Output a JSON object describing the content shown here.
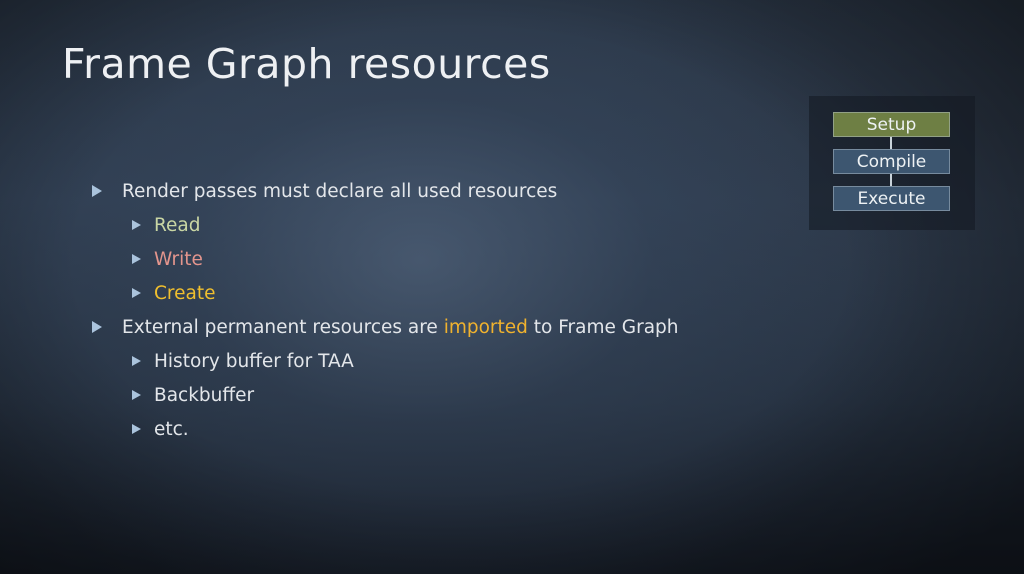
{
  "slide": {
    "title": "Frame Graph resources",
    "bullets": [
      {
        "text": "Render passes must declare all used resources",
        "sub": [
          {
            "text": "Read",
            "color": "#c9d6a4"
          },
          {
            "text": "Write",
            "color": "#e3958d"
          },
          {
            "text": "Create",
            "color": "#f0bf2e"
          }
        ]
      },
      {
        "text_before": "External permanent resources are ",
        "highlight": "imported",
        "text_after": " to Frame Graph",
        "highlight_color": "#f0b22e",
        "sub": [
          {
            "text": "History buffer for TAA"
          },
          {
            "text": "Backbuffer"
          },
          {
            "text": "etc."
          }
        ]
      }
    ],
    "bullet_icon": "triangle-right-icon"
  },
  "pipeline": {
    "stages": [
      {
        "label": "Setup",
        "color": "#6e7f44",
        "active": true
      },
      {
        "label": "Compile",
        "color": "#3d5670",
        "active": false
      },
      {
        "label": "Execute",
        "color": "#3d5670",
        "active": false
      }
    ]
  }
}
